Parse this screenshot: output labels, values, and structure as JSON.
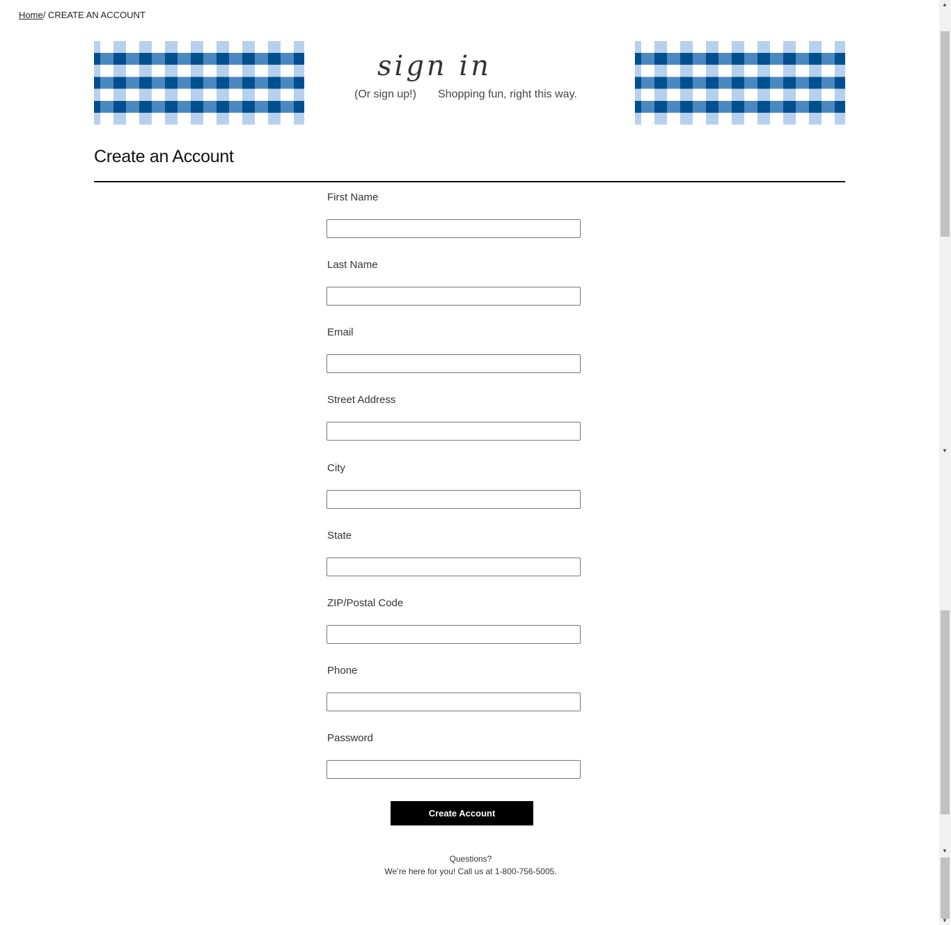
{
  "breadcrumb": {
    "home": "Home",
    "separator": "/",
    "current": " CREATE AN ACCOUNT"
  },
  "banner": {
    "script_title": "sign in",
    "subtitle_left": "(Or sign up!)",
    "subtitle_right": "Shopping fun, right this way.",
    "colors": {
      "dark": "#00508f",
      "mid": "#4a88c0",
      "light": "#b7d0ee"
    }
  },
  "page_title": "Create an Account",
  "fields": [
    {
      "label": "First Name",
      "value": ""
    },
    {
      "label": "Last Name",
      "value": ""
    },
    {
      "label": "Email",
      "value": ""
    },
    {
      "label": "Street Address",
      "value": ""
    },
    {
      "label": "City",
      "value": ""
    },
    {
      "label": "State",
      "value": ""
    },
    {
      "label": "ZIP/Postal Code",
      "value": ""
    },
    {
      "label": "Phone",
      "value": ""
    },
    {
      "label": "Password",
      "value": ""
    }
  ],
  "submit_label": "Create Account",
  "footer": {
    "questions": "Questions?",
    "contact": "We’re here for you! Call us at 1-800-756-5005."
  }
}
